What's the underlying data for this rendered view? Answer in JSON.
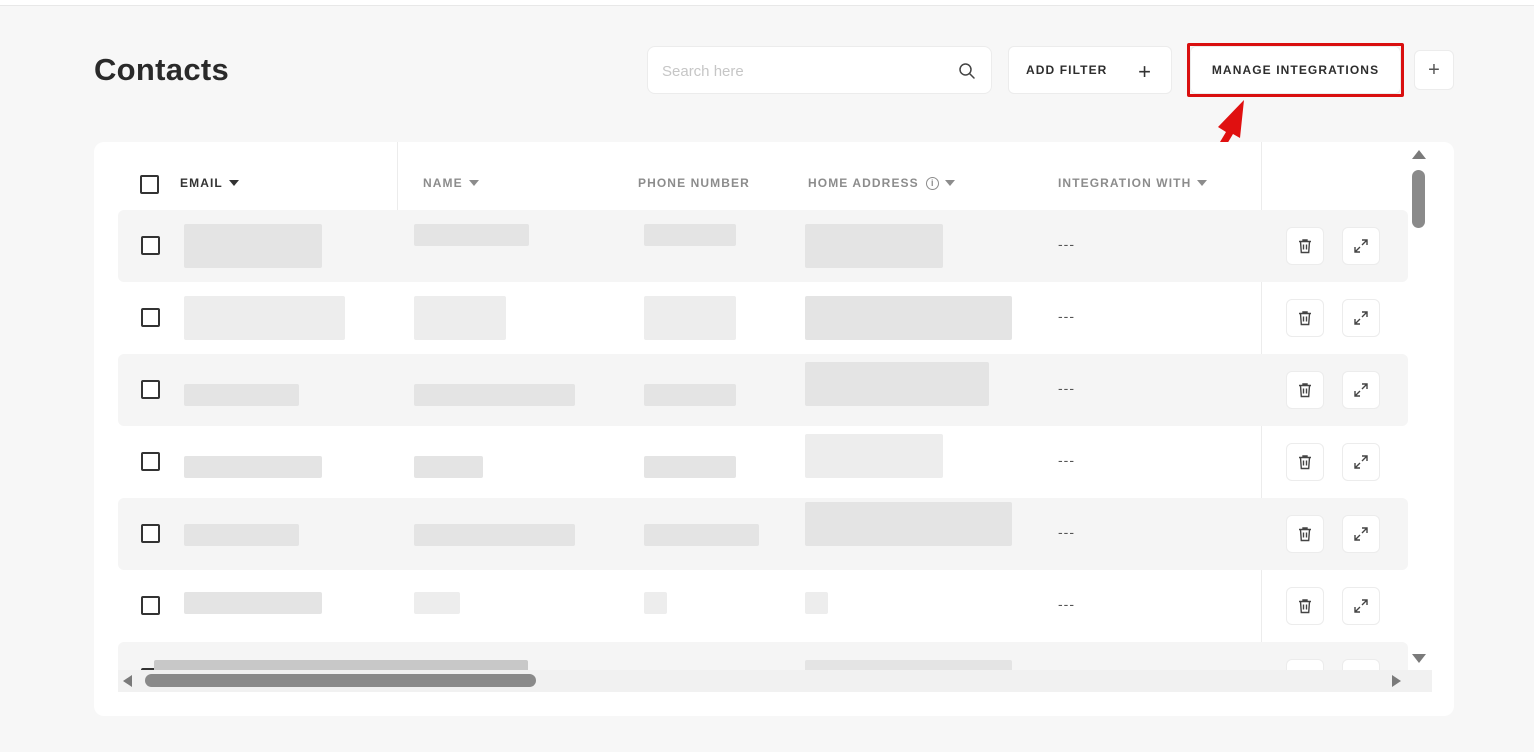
{
  "page": {
    "title": "Contacts"
  },
  "search": {
    "placeholder": "Search here",
    "value": ""
  },
  "toolbar": {
    "add_filter_label": "ADD FILTER",
    "add_filter_icon": "plus-icon",
    "manage_integrations_label": "MANAGE INTEGRATIONS",
    "add_icon": "plus-icon"
  },
  "annotation": {
    "highlight_color": "#d90f0f",
    "target": "manage-integrations-button"
  },
  "table": {
    "columns": [
      {
        "label": "EMAIL",
        "sortable": true
      },
      {
        "label": "NAME",
        "sortable": true
      },
      {
        "label": "PHONE NUMBER",
        "sortable": false
      },
      {
        "label": "HOME ADDRESS",
        "sortable": true,
        "info": true
      },
      {
        "label": "INTEGRATION WITH",
        "sortable": true
      }
    ],
    "rows": [
      {
        "integration": "---"
      },
      {
        "integration": "---"
      },
      {
        "integration": "---"
      },
      {
        "integration": "---"
      },
      {
        "integration": "---"
      },
      {
        "integration": "---"
      }
    ],
    "row_actions": [
      "trash-icon",
      "expand-icon"
    ],
    "note": "cell contents are pixelated / redacted"
  },
  "colors": {
    "background": "#f7f7f7",
    "card": "#ffffff",
    "text": "#2b2b2b",
    "muted": "#8c8c8c"
  }
}
